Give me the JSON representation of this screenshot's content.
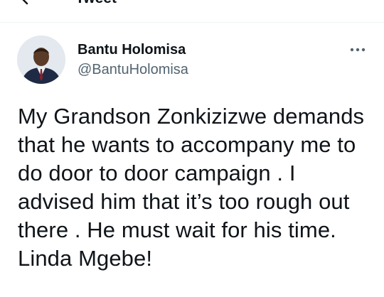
{
  "header": {
    "title": "Tweet",
    "back_icon": "arrow-left-icon"
  },
  "tweet": {
    "author": {
      "display_name": "Bantu Holomisa",
      "handle": "@BantuHolomisa",
      "avatar_icon": "profile-photo"
    },
    "more_icon": "more-horizontal-icon",
    "text": "My Grandson Zonkizizwe demands that he wants to accompany me to do door to door campaign . I advised him that it’s too rough out there . He must wait for his time. Linda Mgebe!"
  },
  "colors": {
    "text_primary": "#0f1419",
    "text_secondary": "#536471",
    "divider": "#eff3f4"
  }
}
